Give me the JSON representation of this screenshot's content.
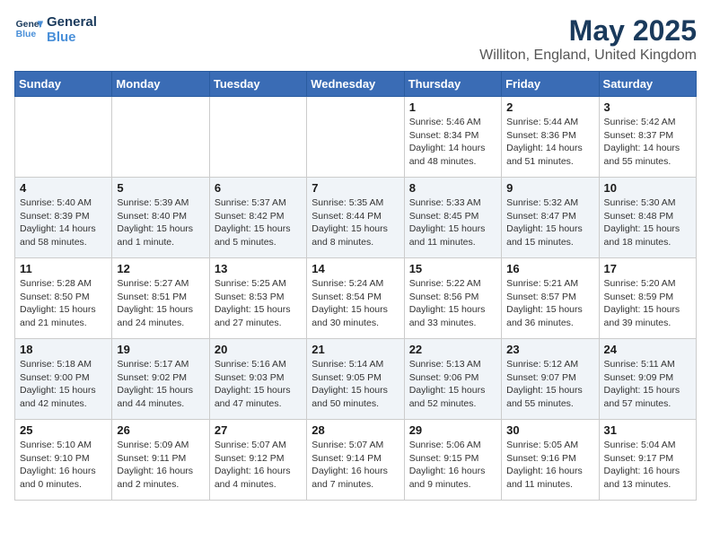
{
  "logo": {
    "line1": "General",
    "line2": "Blue"
  },
  "title": "May 2025",
  "subtitle": "Williton, England, United Kingdom",
  "days_of_week": [
    "Sunday",
    "Monday",
    "Tuesday",
    "Wednesday",
    "Thursday",
    "Friday",
    "Saturday"
  ],
  "weeks": [
    [
      {
        "num": "",
        "detail": ""
      },
      {
        "num": "",
        "detail": ""
      },
      {
        "num": "",
        "detail": ""
      },
      {
        "num": "",
        "detail": ""
      },
      {
        "num": "1",
        "detail": "Sunrise: 5:46 AM\nSunset: 8:34 PM\nDaylight: 14 hours\nand 48 minutes."
      },
      {
        "num": "2",
        "detail": "Sunrise: 5:44 AM\nSunset: 8:36 PM\nDaylight: 14 hours\nand 51 minutes."
      },
      {
        "num": "3",
        "detail": "Sunrise: 5:42 AM\nSunset: 8:37 PM\nDaylight: 14 hours\nand 55 minutes."
      }
    ],
    [
      {
        "num": "4",
        "detail": "Sunrise: 5:40 AM\nSunset: 8:39 PM\nDaylight: 14 hours\nand 58 minutes."
      },
      {
        "num": "5",
        "detail": "Sunrise: 5:39 AM\nSunset: 8:40 PM\nDaylight: 15 hours\nand 1 minute."
      },
      {
        "num": "6",
        "detail": "Sunrise: 5:37 AM\nSunset: 8:42 PM\nDaylight: 15 hours\nand 5 minutes."
      },
      {
        "num": "7",
        "detail": "Sunrise: 5:35 AM\nSunset: 8:44 PM\nDaylight: 15 hours\nand 8 minutes."
      },
      {
        "num": "8",
        "detail": "Sunrise: 5:33 AM\nSunset: 8:45 PM\nDaylight: 15 hours\nand 11 minutes."
      },
      {
        "num": "9",
        "detail": "Sunrise: 5:32 AM\nSunset: 8:47 PM\nDaylight: 15 hours\nand 15 minutes."
      },
      {
        "num": "10",
        "detail": "Sunrise: 5:30 AM\nSunset: 8:48 PM\nDaylight: 15 hours\nand 18 minutes."
      }
    ],
    [
      {
        "num": "11",
        "detail": "Sunrise: 5:28 AM\nSunset: 8:50 PM\nDaylight: 15 hours\nand 21 minutes."
      },
      {
        "num": "12",
        "detail": "Sunrise: 5:27 AM\nSunset: 8:51 PM\nDaylight: 15 hours\nand 24 minutes."
      },
      {
        "num": "13",
        "detail": "Sunrise: 5:25 AM\nSunset: 8:53 PM\nDaylight: 15 hours\nand 27 minutes."
      },
      {
        "num": "14",
        "detail": "Sunrise: 5:24 AM\nSunset: 8:54 PM\nDaylight: 15 hours\nand 30 minutes."
      },
      {
        "num": "15",
        "detail": "Sunrise: 5:22 AM\nSunset: 8:56 PM\nDaylight: 15 hours\nand 33 minutes."
      },
      {
        "num": "16",
        "detail": "Sunrise: 5:21 AM\nSunset: 8:57 PM\nDaylight: 15 hours\nand 36 minutes."
      },
      {
        "num": "17",
        "detail": "Sunrise: 5:20 AM\nSunset: 8:59 PM\nDaylight: 15 hours\nand 39 minutes."
      }
    ],
    [
      {
        "num": "18",
        "detail": "Sunrise: 5:18 AM\nSunset: 9:00 PM\nDaylight: 15 hours\nand 42 minutes."
      },
      {
        "num": "19",
        "detail": "Sunrise: 5:17 AM\nSunset: 9:02 PM\nDaylight: 15 hours\nand 44 minutes."
      },
      {
        "num": "20",
        "detail": "Sunrise: 5:16 AM\nSunset: 9:03 PM\nDaylight: 15 hours\nand 47 minutes."
      },
      {
        "num": "21",
        "detail": "Sunrise: 5:14 AM\nSunset: 9:05 PM\nDaylight: 15 hours\nand 50 minutes."
      },
      {
        "num": "22",
        "detail": "Sunrise: 5:13 AM\nSunset: 9:06 PM\nDaylight: 15 hours\nand 52 minutes."
      },
      {
        "num": "23",
        "detail": "Sunrise: 5:12 AM\nSunset: 9:07 PM\nDaylight: 15 hours\nand 55 minutes."
      },
      {
        "num": "24",
        "detail": "Sunrise: 5:11 AM\nSunset: 9:09 PM\nDaylight: 15 hours\nand 57 minutes."
      }
    ],
    [
      {
        "num": "25",
        "detail": "Sunrise: 5:10 AM\nSunset: 9:10 PM\nDaylight: 16 hours\nand 0 minutes."
      },
      {
        "num": "26",
        "detail": "Sunrise: 5:09 AM\nSunset: 9:11 PM\nDaylight: 16 hours\nand 2 minutes."
      },
      {
        "num": "27",
        "detail": "Sunrise: 5:07 AM\nSunset: 9:12 PM\nDaylight: 16 hours\nand 4 minutes."
      },
      {
        "num": "28",
        "detail": "Sunrise: 5:07 AM\nSunset: 9:14 PM\nDaylight: 16 hours\nand 7 minutes."
      },
      {
        "num": "29",
        "detail": "Sunrise: 5:06 AM\nSunset: 9:15 PM\nDaylight: 16 hours\nand 9 minutes."
      },
      {
        "num": "30",
        "detail": "Sunrise: 5:05 AM\nSunset: 9:16 PM\nDaylight: 16 hours\nand 11 minutes."
      },
      {
        "num": "31",
        "detail": "Sunrise: 5:04 AM\nSunset: 9:17 PM\nDaylight: 16 hours\nand 13 minutes."
      }
    ]
  ]
}
